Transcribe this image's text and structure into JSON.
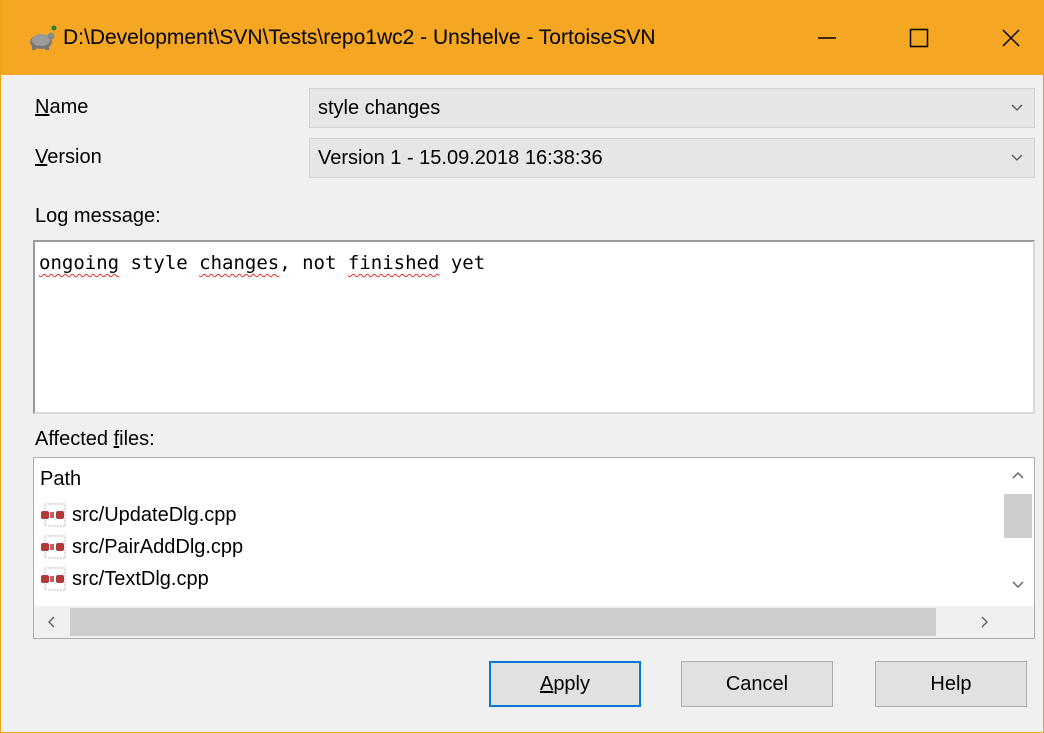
{
  "window": {
    "title": "D:\\Development\\SVN\\Tests\\repo1wc2 - Unshelve - TortoiseSVN",
    "accent_color": "#f5a623",
    "controls": {
      "minimize_icon": "minimize-icon",
      "maximize_icon": "maximize-icon",
      "close_icon": "close-icon"
    }
  },
  "form": {
    "name_label_accel": "N",
    "name_label_rest": "ame",
    "name_value": "style changes",
    "version_label_accel": "V",
    "version_label_rest": "ersion",
    "version_value": "Version 1 - 15.09.2018 16:38:36",
    "log_label": "Log message:",
    "log_words": [
      "ongoing",
      " style ",
      "changes",
      ", not ",
      "finished",
      " yet"
    ],
    "files_label_pre": "Affected ",
    "files_label_accel": "f",
    "files_label_rest": "iles:"
  },
  "files": {
    "column_header": "Path",
    "rows": [
      "src/UpdateDlg.cpp",
      "src/PairAddDlg.cpp",
      "src/TextDlg.cpp"
    ]
  },
  "buttons": {
    "apply_accel": "A",
    "apply_rest": "pply",
    "cancel": "Cancel",
    "help": "Help"
  }
}
